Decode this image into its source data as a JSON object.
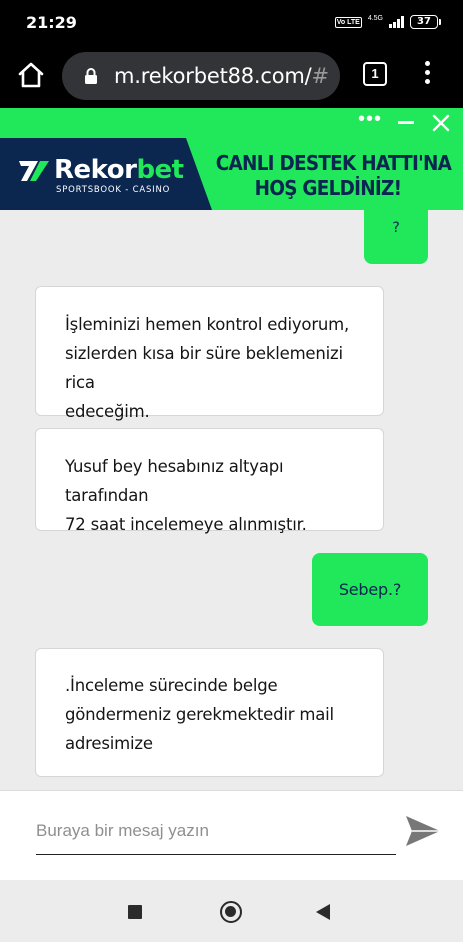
{
  "status_bar": {
    "time": "21:29",
    "volte": "Vo LTE",
    "network": "4.5G",
    "battery": "37"
  },
  "browser": {
    "url_domain": "m.rekorbet88.com/",
    "url_hash": "#",
    "tab_count": "1"
  },
  "chat_header": {
    "logo_prefix": "Rekor",
    "logo_suffix": "bet",
    "logo_sub": "SPORTSBOOK - CASINO",
    "welcome_line1": "CANLI DESTEK HATTI'NA",
    "welcome_line2": "HOŞ GELDİNİZ!",
    "colors": {
      "green": "#21e85a",
      "navy": "#0b2750"
    }
  },
  "messages": [
    {
      "from": "user",
      "lines": [
        "?"
      ]
    },
    {
      "from": "agent",
      "lines": [
        "İşleminizi hemen kontrol ediyorum,",
        "sizlerden kısa bir süre beklemenizi rica",
        "edeceğim."
      ]
    },
    {
      "from": "agent",
      "lines": [
        "Yusuf bey hesabınız altyapı tarafından",
        "72 saat incelemeye alınmıştır."
      ]
    },
    {
      "from": "user",
      "lines": [
        "Sebep.?"
      ]
    },
    {
      "from": "agent",
      "lines": [
        ".İnceleme sürecinde belge",
        "göndermeniz gerekmektedir mail",
        "adresimize"
      ]
    }
  ],
  "composer": {
    "placeholder": "Buraya bir mesaj yazın",
    "send_icon": "paper-plane-icon"
  },
  "nav": {
    "recents_icon": "square-icon",
    "home_icon": "circle-icon",
    "back_icon": "triangle-back-icon"
  }
}
